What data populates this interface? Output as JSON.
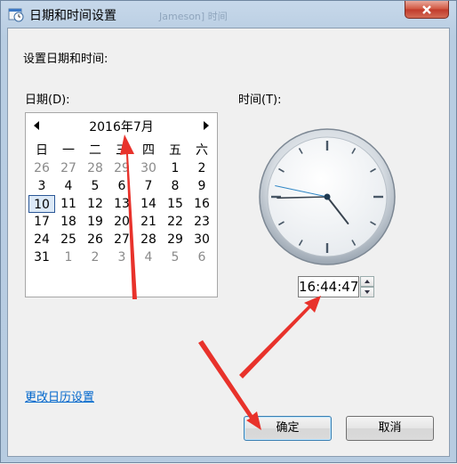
{
  "window": {
    "title": "日期和时间设置",
    "ghost_title": "Jameson] 时间",
    "close_icon": "close-icon"
  },
  "dialog": {
    "heading": "设置日期和时间:",
    "date_label": "日期(D):",
    "time_label": "时间(T):",
    "change_calendar_link": "更改日历设置",
    "ok_label": "确定",
    "cancel_label": "取消"
  },
  "calendar": {
    "month_title": "2016年7月",
    "weekdays": [
      "日",
      "一",
      "二",
      "三",
      "四",
      "五",
      "六"
    ],
    "days": [
      [
        "26",
        "27",
        "28",
        "29",
        "30",
        "1",
        "2"
      ],
      [
        "3",
        "4",
        "5",
        "6",
        "7",
        "8",
        "9"
      ],
      [
        "10",
        "11",
        "12",
        "13",
        "14",
        "15",
        "16"
      ],
      [
        "17",
        "18",
        "19",
        "20",
        "21",
        "22",
        "23"
      ],
      [
        "24",
        "25",
        "26",
        "27",
        "28",
        "29",
        "30"
      ],
      [
        "31",
        "1",
        "2",
        "3",
        "4",
        "5",
        "6"
      ]
    ],
    "dimmed_prev": 5,
    "dimmed_next_start_row": 5,
    "selected_day": "10"
  },
  "clock": {
    "time_value": "16:44:47",
    "hours": 16,
    "minutes": 44,
    "seconds": 47
  },
  "colors": {
    "link": "#0066cc",
    "annotation_arrow": "#e8322b"
  }
}
